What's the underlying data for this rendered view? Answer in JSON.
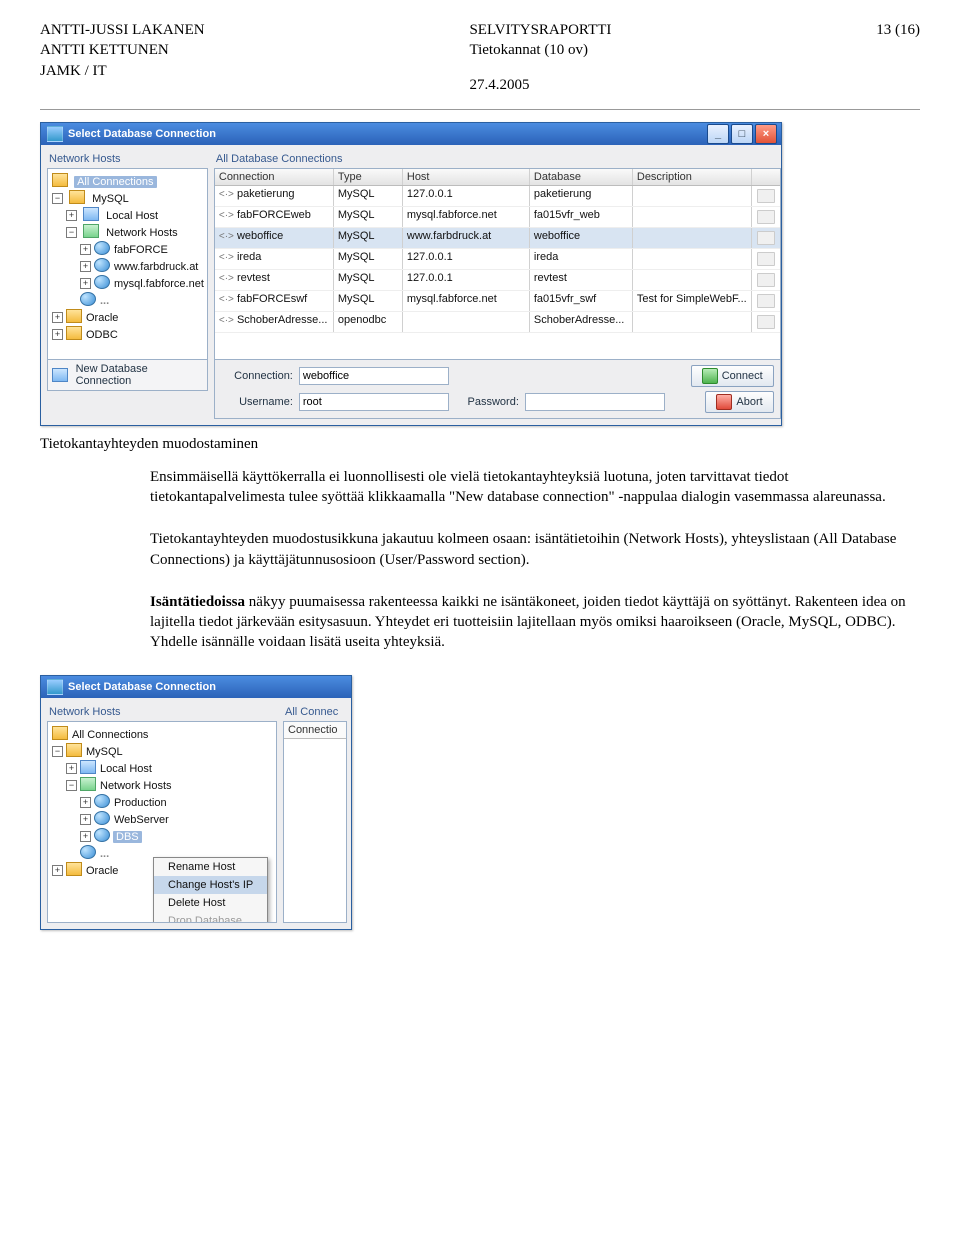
{
  "header": {
    "left1": "ANTTI-JUSSI LAKANEN",
    "left2": "ANTTI KETTUNEN",
    "left3": "JAMK / IT",
    "mid1": "SELVITYSRAPORTTI",
    "mid2": "Tietokannat (10 ov)",
    "mid3": "27.4.2005",
    "right1": "13 (16)"
  },
  "dialog1": {
    "title": "Select Database Connection",
    "btn_min": "_",
    "btn_max": "□",
    "btn_close": "×",
    "left_label": "Network Hosts",
    "right_label": "All Database Connections",
    "tree": {
      "root": "All Connections",
      "nodes": [
        {
          "exp": "−",
          "icon": "i-folder",
          "label": "MySQL",
          "children": [
            {
              "exp": "+",
              "icon": "i-host",
              "label": "Local Host"
            },
            {
              "exp": "−",
              "icon": "i-net",
              "label": "Network Hosts",
              "children": [
                {
                  "exp": "+",
                  "icon": "i-globe",
                  "label": "fabFORCE"
                },
                {
                  "exp": "+",
                  "icon": "i-globe",
                  "label": "www.farbdruck.at"
                },
                {
                  "exp": "+",
                  "icon": "i-globe",
                  "label": "mysql.fabforce.net"
                },
                {
                  "dots": "..."
                }
              ]
            }
          ]
        },
        {
          "exp": "+",
          "icon": "i-folder",
          "label": "Oracle"
        },
        {
          "exp": "+",
          "icon": "i-folder",
          "label": "ODBC"
        }
      ]
    },
    "columns": [
      "Connection",
      "Type",
      "Host",
      "Database",
      "Description",
      ""
    ],
    "rows": [
      {
        "c0": "paketierung",
        "c1": "MySQL",
        "c2": "127.0.0.1",
        "c3": "paketierung",
        "c4": ""
      },
      {
        "c0": "fabFORCEweb",
        "c1": "MySQL",
        "c2": "mysql.fabforce.net",
        "c3": "fa015vfr_web",
        "c4": ""
      },
      {
        "c0": "weboffice",
        "c1": "MySQL",
        "c2": "www.farbdruck.at",
        "c3": "weboffice",
        "c4": "",
        "sel": true
      },
      {
        "c0": "ireda",
        "c1": "MySQL",
        "c2": "127.0.0.1",
        "c3": "ireda",
        "c4": ""
      },
      {
        "c0": "revtest",
        "c1": "MySQL",
        "c2": "127.0.0.1",
        "c3": "revtest",
        "c4": ""
      },
      {
        "c0": "fabFORCEswf",
        "c1": "MySQL",
        "c2": "mysql.fabforce.net",
        "c3": "fa015vfr_swf",
        "c4": "Test for SimpleWebF..."
      },
      {
        "c0": "SchoberAdresse...",
        "c1": "openodbc",
        "c2": "",
        "c3": "SchoberAdresse...",
        "c4": ""
      }
    ],
    "new_conn_label": "New Database Connection",
    "form": {
      "l_conn": "Connection:",
      "v_conn": "weboffice",
      "l_user": "Username:",
      "v_user": "root",
      "l_pass": "Password:",
      "v_pass": "",
      "btn_connect": "Connect",
      "btn_abort": "Abort"
    }
  },
  "section_title": "Tietokantayhteyden muodostaminen",
  "para1": "Ensimmäisellä käyttökerralla ei luonnollisesti ole vielä tietokantayhteyksiä luotuna, joten tarvittavat tiedot tietokantapalvelimesta tulee syöttää klikkaamalla \"New database connection\" -nappulaa dialogin vasemmassa alareunassa.",
  "para2": "Tietokantayhteyden muodostusikkuna jakautuu kolmeen osaan: isäntätietoihin (Network Hosts), yhteyslistaan (All Database Connections) ja käyttäjätunnusosioon (User/Password section).",
  "para3a": "Isäntätiedoissa",
  "para3b": " näkyy puumaisessa rakenteessa kaikki ne isäntäkoneet, joiden tiedot käyttäjä on syöttänyt. Rakenteen idea on lajitella tiedot järkevään esitysasuun. Yhteydet eri tuotteisiin lajitellaan myös omiksi haaroikseen (Oracle, MySQL, ODBC). Yhdelle isännälle voidaan lisätä useita yhteyksiä.",
  "dialog2": {
    "title": "Select Database Connection",
    "left_label": "Network Hosts",
    "right_label_a": "All Connec",
    "right_label_b": "Connectio",
    "tree": {
      "root": "All Connections",
      "mysql": "MySQL",
      "local": "Local Host",
      "net": "Network Hosts",
      "prod": "Production",
      "webs": "WebServer",
      "dbs": "DBS",
      "dots": "...",
      "oracle": "Oracle"
    },
    "ctx": {
      "rename": "Rename Host",
      "change": "Change Host's IP",
      "delete": "Delete Host",
      "drop": "Drop Database"
    }
  }
}
